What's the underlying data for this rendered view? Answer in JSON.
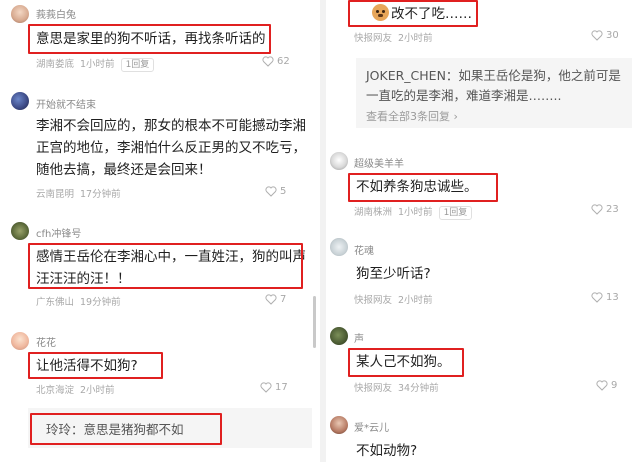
{
  "left": {
    "c1": {
      "username": "莪莪白兔",
      "text": "意思是家里的狗不听话，再找条听话的",
      "location": "湖南娄底",
      "time": "1小时前",
      "reply": "1回复",
      "likes": "62"
    },
    "c2": {
      "username": "开始就不结束",
      "text": "李湘不会回应的，那女的根本不可能撼动李湘正宫的地位，李湘怕什么反正男的又不吃亏，随他去搞，最终还是会回来！",
      "location": "云南昆明",
      "time": "17分钟前",
      "likes": "5"
    },
    "c3": {
      "username": "cfh冲锋号",
      "text": "感情王岳伦在李湘心中，一直姓汪，狗的叫声汪汪汪的汪！！",
      "location": "广东佛山",
      "time": "19分钟前",
      "likes": "7"
    },
    "c4": {
      "username": "花花",
      "text": "让他活得不如狗?",
      "location": "北京海淀",
      "time": "2小时前",
      "likes": "17"
    },
    "c5": {
      "reply_text": "玲玲：意思是猪狗都不如"
    }
  },
  "right": {
    "r1": {
      "text": "改不了吃……",
      "location": "快报网友",
      "time": "2小时前",
      "likes": "30"
    },
    "r1_reply": {
      "text": "JOKER_CHEN：如果王岳伦是狗，他之前可是一直吃的是李湘，难道李湘是……..",
      "more": "查看全部3条回复 ›"
    },
    "r2": {
      "username": "超级美羊羊",
      "text": "不如养条狗忠诚些。",
      "location": "湖南株洲",
      "time": "1小时前",
      "reply": "1回复",
      "likes": "23"
    },
    "r3": {
      "username": "花魂",
      "text": "狗至少听话?",
      "location": "快报网友",
      "time": "2小时前",
      "likes": "13"
    },
    "r4": {
      "username": "声",
      "text": "某人己不如狗。",
      "location": "快报网友",
      "time": "34分钟前",
      "likes": "9"
    },
    "r5": {
      "username": "爱*云儿",
      "text": "不如动物?"
    }
  },
  "colors": {
    "highlight": "#e02020",
    "meta": "#a8a8a8",
    "username": "#8a8a8a"
  }
}
